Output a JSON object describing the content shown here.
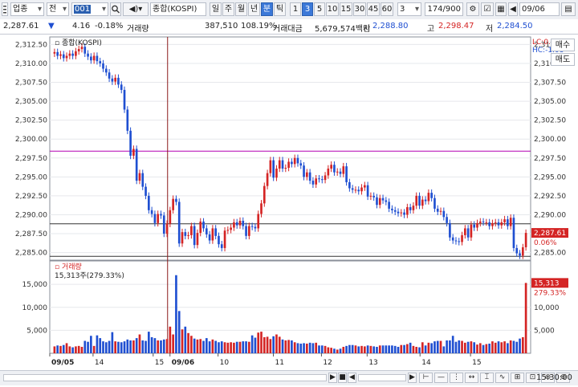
{
  "toolbar": {
    "market_select": "업종",
    "market_mode": "전",
    "code_value": "001",
    "index_name": "종합(KOSPI)",
    "period_tabs": [
      "일",
      "주",
      "월",
      "년",
      "분",
      "틱"
    ],
    "active_period": "분",
    "interval_buttons": [
      "1",
      "3",
      "5",
      "10",
      "15",
      "30",
      "45",
      "60"
    ],
    "active_interval": "3",
    "interval_value": "3",
    "page_counter": "174/900",
    "date_value": "09/06"
  },
  "quote": {
    "price": "2,287.61",
    "change": "4.16",
    "change_pct": "-0.18%",
    "volume_label": "거래량",
    "volume_value": "387,510",
    "volume_ratio": "108.19%",
    "amount_label": "거래대금",
    "amount_value": "5,679,574백만",
    "open_label": "시",
    "open_value": "2,288.80",
    "high_label": "고",
    "high_value": "2,298.47",
    "low_label": "저",
    "low_value": "2,284.50"
  },
  "side": {
    "buy_label": "매수",
    "sell_label": "매도"
  },
  "price_panel": {
    "title": "종합(KOSPI)",
    "lc_label": "LC:0.14",
    "hc_label": "HC:-1.08",
    "current_price_label": "2,287.61",
    "current_pct_label": "0.06%"
  },
  "volume_panel": {
    "title": "거래량",
    "summary": "15,313주(279.33%)",
    "current_volume_label": "15,313",
    "current_pct_label": "279.33%"
  },
  "time_label": "15:30:00",
  "colors": {
    "up": "#d42424",
    "down": "#1f4fd1",
    "accent": "#3b78d8",
    "hline_magenta": "#b300b3",
    "vline": "#8b1a1a"
  },
  "chart_data": {
    "type": "candlestick",
    "y_ticks": [
      "2,312.50",
      "2,310.00",
      "2,307.50",
      "2,305.00",
      "2,302.50",
      "2,300.00",
      "2,297.50",
      "2,295.00",
      "2,292.50",
      "2,290.00",
      "2,287.50",
      "2,285.00"
    ],
    "ylim": [
      2284.0,
      2313.5
    ],
    "volume_ticks": [
      "15,000",
      "10,000",
      "5,000"
    ],
    "volume_ylim": [
      0,
      18000
    ],
    "x_labels": [
      "09/05",
      "14",
      "15",
      "09/06",
      "10",
      "11",
      "12",
      "13",
      "14",
      "15"
    ],
    "horizontal_lines": [
      2298.4,
      2288.8,
      2284.5
    ],
    "closes": [
      2311.5,
      2311.0,
      2311.2,
      2310.7,
      2311.0,
      2311.3,
      2311.0,
      2311.6,
      2311.9,
      2312.2,
      2311.3,
      2310.9,
      2310.4,
      2311.0,
      2310.3,
      2310.0,
      2309.3,
      2308.8,
      2308.0,
      2307.6,
      2308.1,
      2307.2,
      2306.5,
      2303.9,
      2301.1,
      2297.8,
      2298.7,
      2294.5,
      2295.5,
      2293.7,
      2292.5,
      2290.6,
      2290.1,
      2288.9,
      2290.1,
      2289.9,
      2287.5,
      2288.8,
      2290.6,
      2292.1,
      2291.7,
      2286.2,
      2287.7,
      2287.2,
      2287.3,
      2288.5,
      2286.0,
      2287.6,
      2289.1,
      2288.2,
      2287.4,
      2286.6,
      2288.2,
      2287.2,
      2286.1,
      2285.6,
      2287.9,
      2288.0,
      2288.3,
      2289.0,
      2288.6,
      2289.2,
      2288.5,
      2287.2,
      2288.5,
      2288.4,
      2288.2,
      2290.1,
      2291.5,
      2293.8,
      2295.5,
      2297.2,
      2294.9,
      2296.1,
      2297.2,
      2296.1,
      2296.2,
      2297.0,
      2296.7,
      2297.5,
      2296.8,
      2296.5,
      2295.0,
      2295.6,
      2294.5,
      2294.0,
      2294.8,
      2294.7,
      2294.6,
      2295.2,
      2296.1,
      2296.6,
      2295.6,
      2295.7,
      2295.4,
      2296.4,
      2294.3,
      2293.5,
      2293.3,
      2293.3,
      2293.1,
      2293.6,
      2293.9,
      2292.4,
      2292.5,
      2292.3,
      2291.3,
      2292.2,
      2291.9,
      2291.7,
      2290.8,
      2290.6,
      2290.4,
      2290.2,
      2290.3,
      2290.0,
      2291.0,
      2290.6,
      2291.2,
      2292.5,
      2291.2,
      2292.0,
      2291.8,
      2292.9,
      2292.2,
      2290.8,
      2290.4,
      2290.5,
      2289.7,
      2288.9,
      2287.0,
      2286.6,
      2286.5,
      2286.4,
      2287.3,
      2288.2,
      2287.0,
      2288.7,
      2288.3,
      2288.9,
      2289.1,
      2289.0,
      2289.0,
      2288.5,
      2288.9,
      2289.0,
      2288.6,
      2289.0,
      2289.4,
      2288.5,
      2289.6,
      2285.6,
      2284.9,
      2284.6,
      2285.7,
      2287.6
    ],
    "volumes": [
      1500,
      1700,
      1600,
      1800,
      2200,
      1500,
      1300,
      1500,
      1600,
      1400,
      2700,
      2500,
      3800,
      1600,
      3900,
      3300,
      2600,
      2400,
      2700,
      4600,
      2600,
      2500,
      2400,
      2600,
      3000,
      2800,
      2800,
      3300,
      4100,
      2800,
      2700,
      4700,
      3500,
      3300,
      2800,
      2800,
      3000,
      3100,
      5800,
      4100,
      17000,
      9200,
      5200,
      5800,
      4400,
      3800,
      3200,
      3000,
      3100,
      2700,
      3300,
      2600,
      3000,
      2700,
      2400,
      2600,
      2400,
      2300,
      2400,
      2300,
      2500,
      2500,
      2600,
      2600,
      2500,
      3900,
      3400,
      4500,
      4700,
      3500,
      3600,
      3100,
      3700,
      4100,
      3600,
      3000,
      2800,
      2900,
      2800,
      2400,
      2200,
      2100,
      2200,
      2100,
      2300,
      2200,
      2300,
      1700,
      1700,
      1600,
      1300,
      1200,
      1000,
      800,
      1000,
      1400,
      1600,
      1800,
      1800,
      1700,
      1500,
      1600,
      1500,
      1700,
      1600,
      1500,
      1400,
      1700,
      1700,
      1700,
      1700,
      1700,
      1600,
      1400,
      1800,
      1800,
      2000,
      2300,
      1600,
      1400,
      1300,
      2400,
      1700,
      2300,
      2200,
      2600,
      2700,
      2700,
      1500,
      2800,
      2800,
      3800,
      2500,
      2800,
      2700,
      2300,
      2500,
      2600,
      2400,
      1900,
      2200,
      1800,
      2000,
      2100,
      2600,
      2300,
      2600,
      2400,
      2600,
      2200,
      2800,
      2700,
      2500,
      3200,
      3500,
      15313
    ]
  }
}
